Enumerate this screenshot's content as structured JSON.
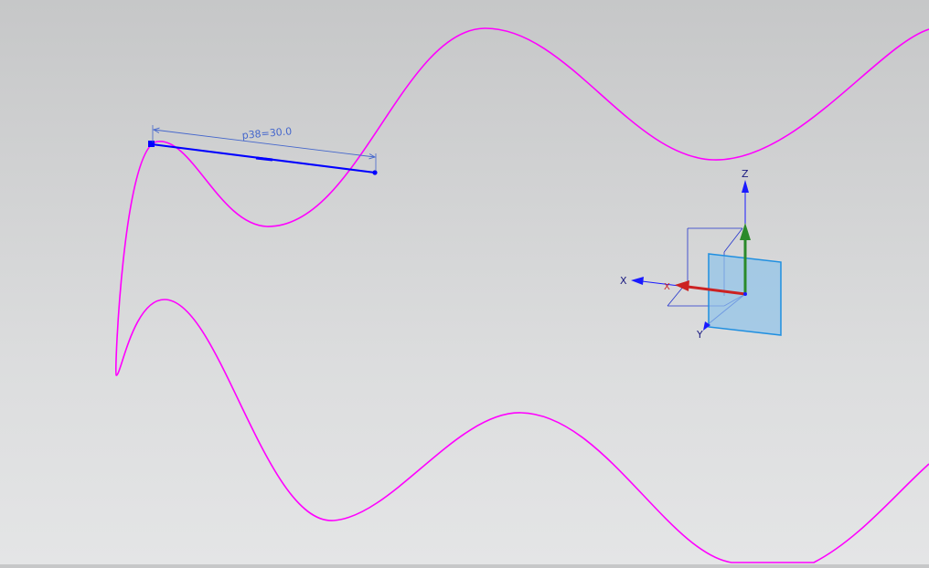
{
  "view": {
    "colors": {
      "curve": "#ff00ff",
      "line": "#0000ff",
      "dimension": "#4466cc",
      "axis_x": "#cc2222",
      "axis_y": "#1a1aff",
      "axis_z": "#2a8a2a",
      "plane_fill": "#8fc3ea",
      "plane_stroke": "#1f8fe0",
      "triad_label": "#1a1a80"
    }
  },
  "dimension": {
    "label": "p38=30.0"
  },
  "triad": {
    "z_label": "Z",
    "x_label": "X",
    "y_label": "Y",
    "x_handle_label": "X"
  }
}
